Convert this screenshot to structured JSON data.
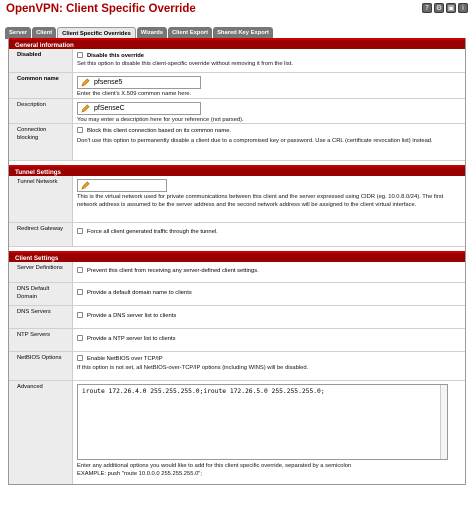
{
  "window": {
    "title": "OpenVPN: Client Specific Override",
    "icons": [
      "help-icon",
      "settings-icon",
      "lock-icon",
      "info-icon"
    ]
  },
  "tabs": [
    {
      "label": "Server",
      "active": false
    },
    {
      "label": "Client",
      "active": false
    },
    {
      "label": "Client Specific Overrides",
      "active": true
    },
    {
      "label": "Wizards",
      "active": false
    },
    {
      "label": "Client Export",
      "active": false
    },
    {
      "label": "Shared Key Export",
      "active": false
    }
  ],
  "general": {
    "header": "General information",
    "disabled": {
      "label": "Disabled",
      "checkbox_label": "Disable this override",
      "checked": false,
      "desc": "Set this option to disable this client-specific override without removing it from the list."
    },
    "common_name": {
      "label": "Common name",
      "value": "pfsense5",
      "desc": "Enter the client's X.509 common name here."
    },
    "description": {
      "label": "Description",
      "value": "pfSenseC",
      "desc": "You may enter a description here for your reference (not parsed)."
    },
    "connection_blocking": {
      "label": "Connection blocking",
      "checkbox_label": "Block this client connection based on its common name.",
      "checked": false,
      "desc": "Don't use this option to permanently disable a client due to a compromised key or password. Use a CRL (certificate revocation list) instead."
    }
  },
  "tunnel": {
    "header": "Tunnel Settings",
    "tunnel_network": {
      "label": "Tunnel Network",
      "value": "",
      "desc": "This is the virtual network used for private communications between this client and the server expressed using CIDR (eg. 10.0.8.0/24). The first network address is assumed to be the server address and the second network address will be assigned to the client virtual interface."
    },
    "redirect_gateway": {
      "label": "Redirect Gateway",
      "checkbox_label": "Force all client generated traffic through the tunnel.",
      "checked": false
    }
  },
  "client": {
    "header": "Client Settings",
    "server_definitions": {
      "label": "Server Definitions",
      "checkbox_label": "Prevent this client from receiving any server-defined client settings.",
      "checked": false
    },
    "dns_default_domain": {
      "label": "DNS Default Domain",
      "checkbox_label": "Provide a default domain name to clients",
      "checked": false
    },
    "dns_servers": {
      "label": "DNS Servers",
      "checkbox_label": "Provide a DNS server list to clients",
      "checked": false
    },
    "ntp_servers": {
      "label": "NTP Servers",
      "checkbox_label": "Provide a NTP server list to clients",
      "checked": false
    },
    "netbios": {
      "label": "NetBIOS Options",
      "checkbox_label": "Enable NetBIOS over TCP/IP",
      "checked": false,
      "desc": "If this option is not set, all NetBIOS-over-TCP/IP options (including WINS) will be disabled."
    },
    "advanced": {
      "label": "Advanced",
      "value": "iroute 172.26.4.0 255.255.255.0;iroute 172.26.5.0 255.255.255.0;",
      "desc1": "Enter any additional options you would like to add for this client specific override, separated by a semicolon",
      "desc2": "EXAMPLE: push \"route 10.0.0.0 255.255.255.0\";"
    }
  }
}
